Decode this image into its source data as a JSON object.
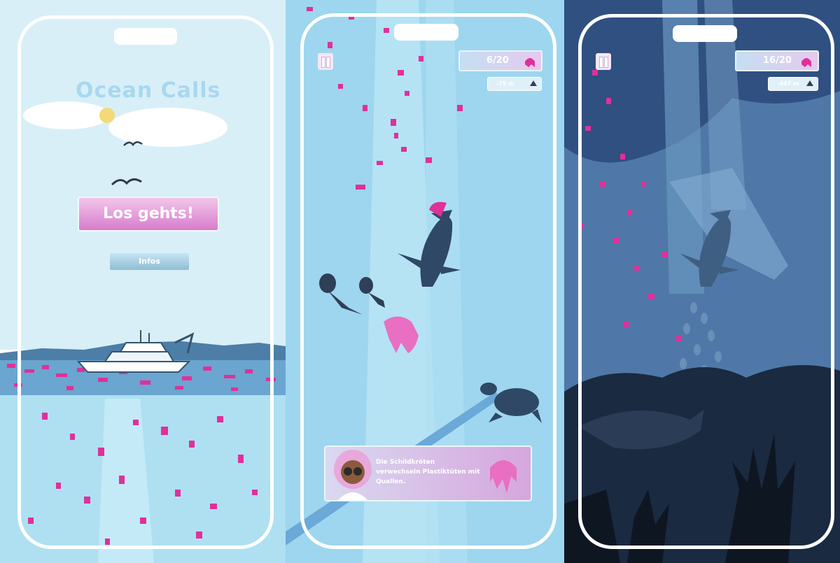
{
  "screen1": {
    "title": "Ocean Calls",
    "start_button": "Los gehts!",
    "info_button": "Infos"
  },
  "screen2": {
    "counter": "6/20",
    "depth": "-75 m",
    "info_text": "Die Schildkröten verwechseln Plastiktüten mit Quallen."
  },
  "screen3": {
    "counter": "16/20",
    "depth": "-447 m"
  },
  "colors": {
    "plastic_pink": "#e0309a",
    "sky": "#d7eef8",
    "water_light": "#a8d9ef",
    "deep_water": "#3f6fa4",
    "frame": "#ffffff"
  },
  "icons": [
    "sun-icon",
    "bird-icon",
    "boat-icon",
    "pause-icon",
    "jellyfish-icon",
    "depth-icon",
    "whale-icon",
    "turtle-icon",
    "shark-icon",
    "scientist-avatar"
  ]
}
